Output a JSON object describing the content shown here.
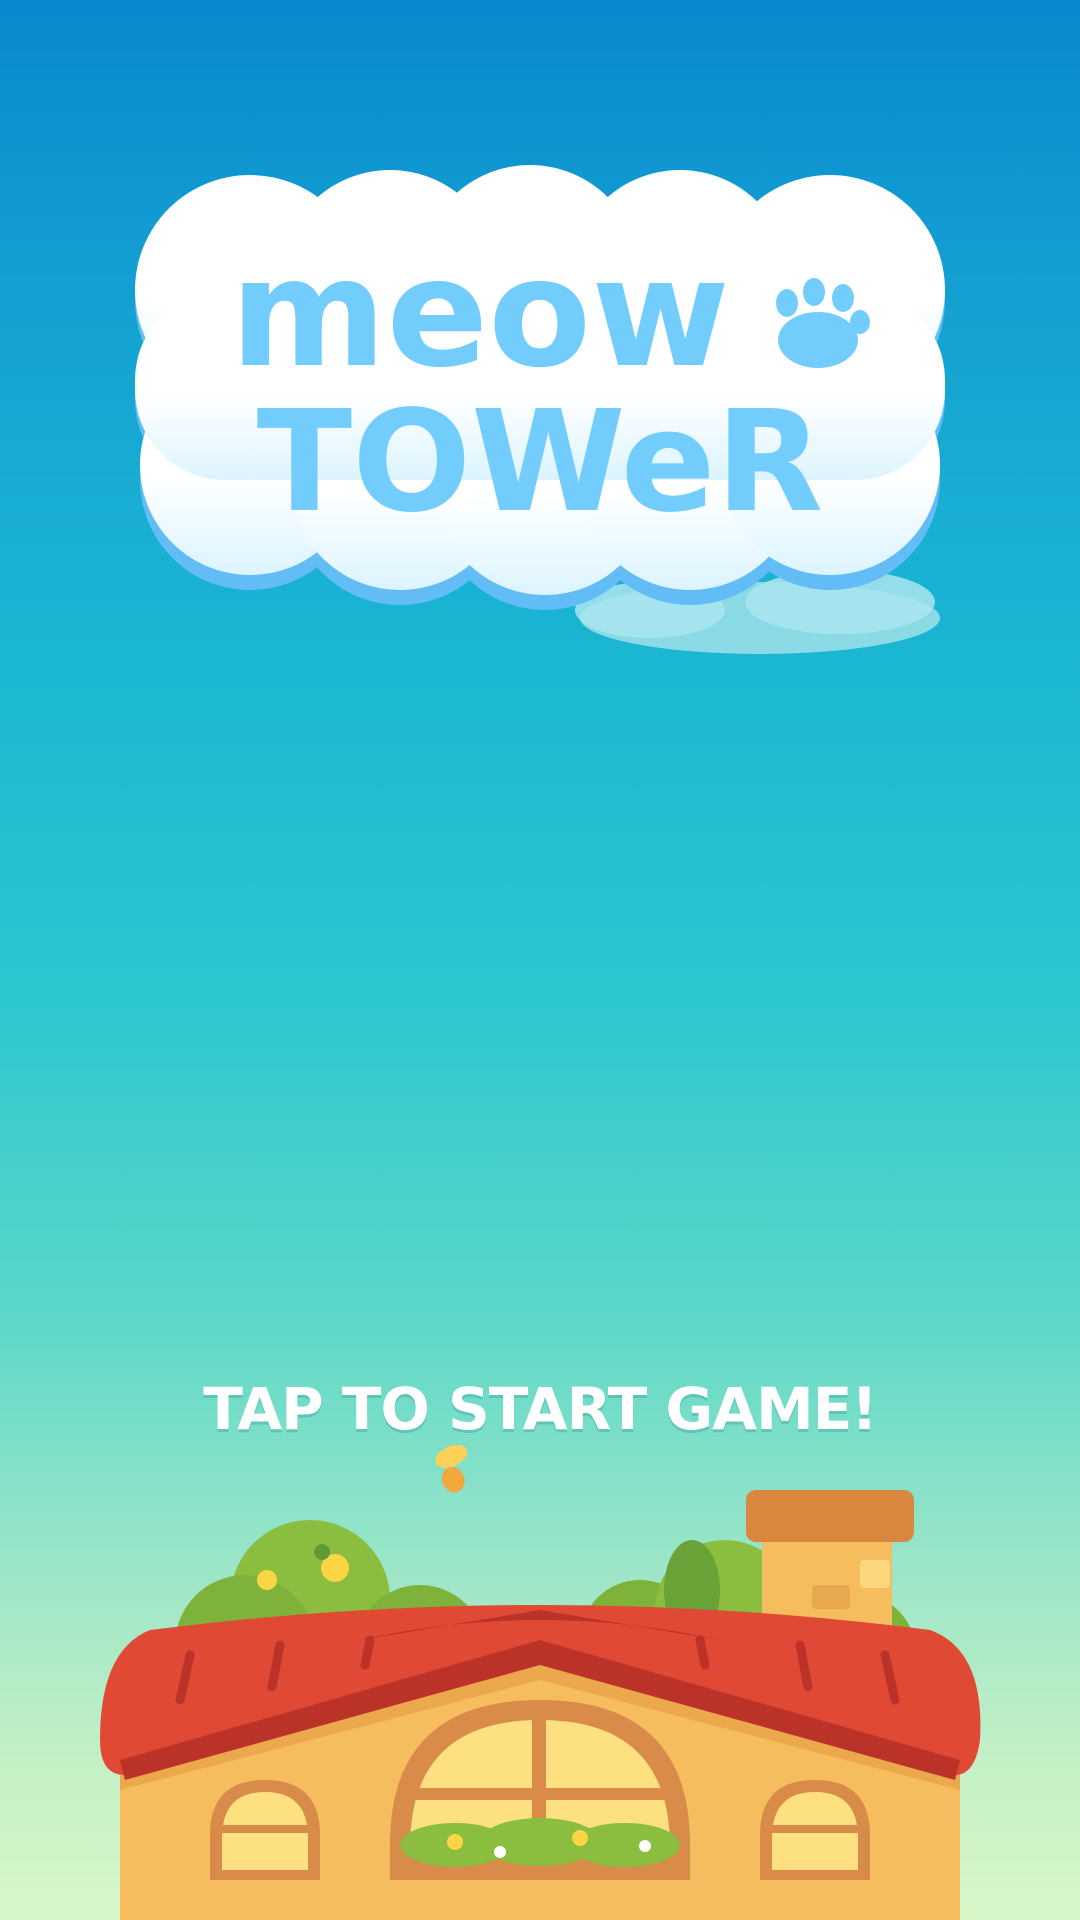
{
  "game": {
    "title_line1": "meow",
    "title_line2": "TOWeR",
    "tap_prompt": "TAP TO START GAME!"
  },
  "colors": {
    "sky_top": "#0789cf",
    "sky_bottom": "#d8f7c9",
    "logo_text": "#72cdfd",
    "roof": "#e04a35",
    "wall": "#f6bd5e",
    "window_glass": "#fde07f",
    "bush": "#8bbd3f"
  },
  "icons": {
    "paw": "paw-icon",
    "butterfly": "butterfly-icon"
  }
}
